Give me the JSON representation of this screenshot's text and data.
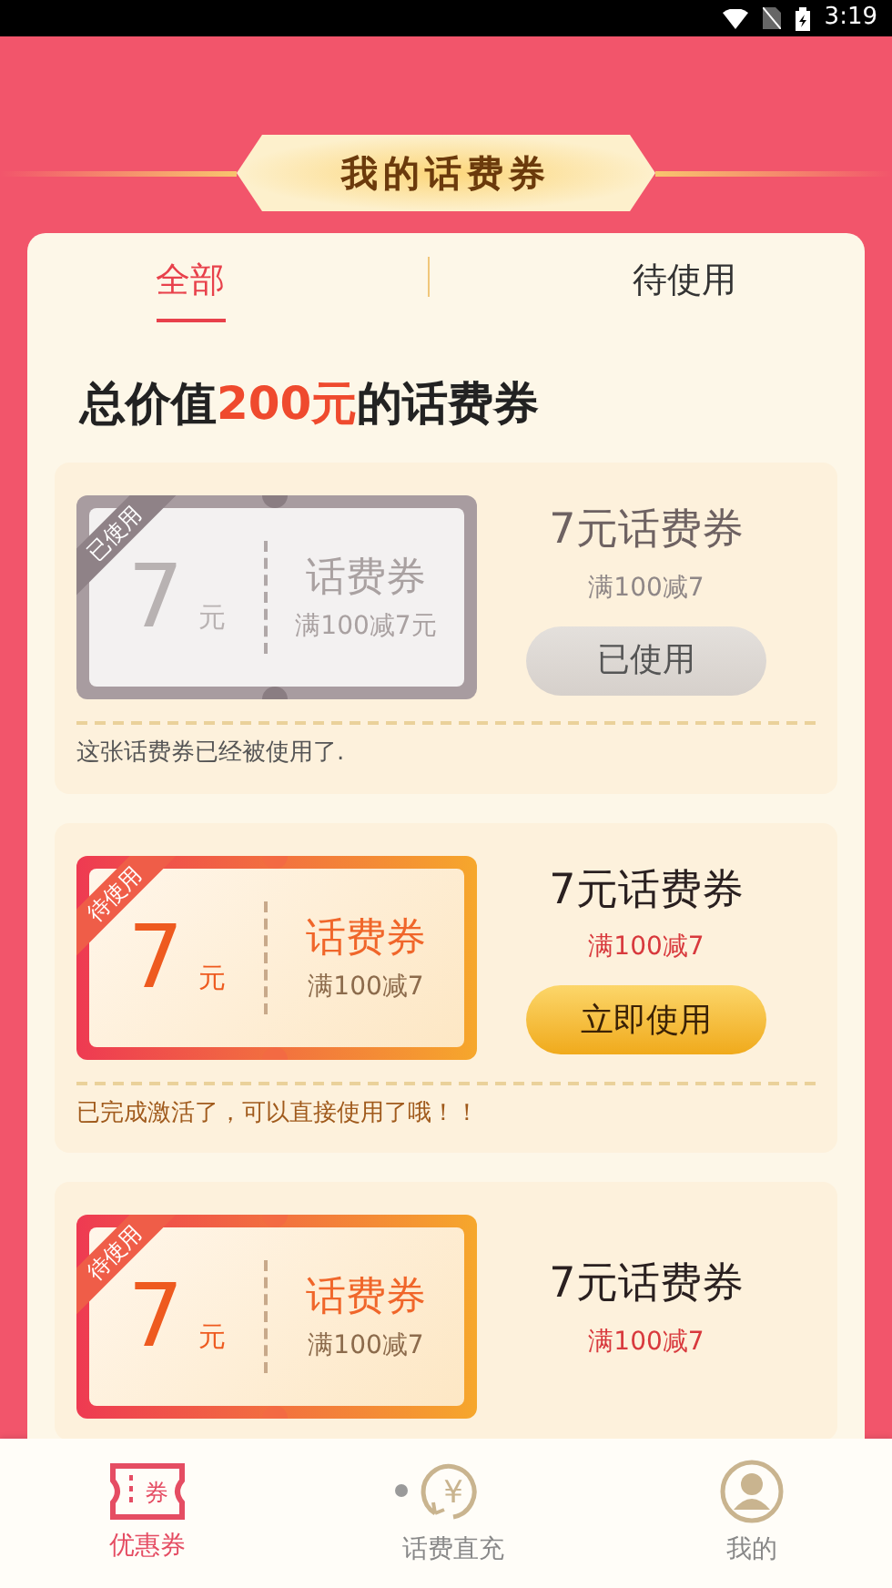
{
  "status_bar": {
    "time": "3:19"
  },
  "banner": {
    "title": "我的话费券"
  },
  "tabs": [
    {
      "label": "全部",
      "selected": true
    },
    {
      "label": "待使用",
      "selected": false
    }
  ],
  "heading": {
    "prefix": "总价值",
    "amount": "200元",
    "suffix": "的话费券"
  },
  "coupons": [
    {
      "kind": "used",
      "corner": "已使用",
      "value": "7",
      "unit": "元",
      "type": "话费券",
      "rule": "满100减7元",
      "title": "7元话费券",
      "condition": "满100减7",
      "action": "已使用",
      "note": "这张话费券已经被使用了."
    },
    {
      "kind": "pending",
      "corner": "待使用",
      "value": "7",
      "unit": "元",
      "type": "话费券",
      "rule": "满100减7",
      "title": "7元话费券",
      "condition": "满100减7",
      "action": "立即使用",
      "note": "已完成激活了，可以直接使用了哦！！"
    },
    {
      "kind": "pending",
      "corner": "待使用",
      "value": "7",
      "unit": "元",
      "type": "话费券",
      "rule": "满100减7",
      "title": "7元话费券",
      "condition": "满100减7"
    }
  ],
  "bottom_nav": [
    {
      "kind": "ticket",
      "icon_text": "券",
      "label": "优惠券",
      "selected": true
    },
    {
      "kind": "yen",
      "icon_text": "¥",
      "label": "话费直充",
      "selected": false,
      "dot": true
    },
    {
      "kind": "user",
      "label": "我的",
      "selected": false
    }
  ]
}
